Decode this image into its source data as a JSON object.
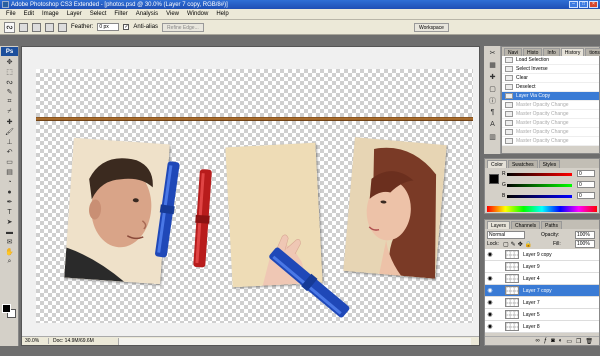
{
  "window": {
    "title": "Adobe Photoshop CS3 Extended - [photos.psd @ 30.0% (Layer 7 copy, RGB/8#)]"
  },
  "menu": [
    "File",
    "Edit",
    "Image",
    "Layer",
    "Select",
    "Filter",
    "Analysis",
    "View",
    "Window",
    "Help"
  ],
  "options": {
    "feather_label": "Feather:",
    "feather_value": "0 px",
    "antialias_label": "Anti-alias",
    "refine_label": "Refine Edge...",
    "workspace_label": "Workspace"
  },
  "toolbox": {
    "badge": "Ps"
  },
  "document": {
    "zoom": "30.0%",
    "doc_info": "Doc: 14.9M/69.6M"
  },
  "history": {
    "tabs": [
      "Navi",
      "Histo",
      "Info",
      "History",
      "tions"
    ],
    "rows": [
      {
        "label": "Load Selection",
        "state": "normal"
      },
      {
        "label": "Select Inverse",
        "state": "normal"
      },
      {
        "label": "Clear",
        "state": "normal"
      },
      {
        "label": "Deselect",
        "state": "normal"
      },
      {
        "label": "Layer Via Copy",
        "state": "selected"
      },
      {
        "label": "Master Opacity Change",
        "state": "dim"
      },
      {
        "label": "Master Opacity Change",
        "state": "dim"
      },
      {
        "label": "Master Opacity Change",
        "state": "dim"
      },
      {
        "label": "Master Opacity Change",
        "state": "dim"
      },
      {
        "label": "Master Opacity Change",
        "state": "dim"
      }
    ]
  },
  "color": {
    "tabs": [
      "Color",
      "Swatches",
      "Styles"
    ],
    "channels": [
      {
        "label": "R",
        "value": "0",
        "color": "#d02020"
      },
      {
        "label": "G",
        "value": "0",
        "color": "#20a020"
      },
      {
        "label": "B",
        "value": "0",
        "color": "#2040d0"
      }
    ]
  },
  "layers": {
    "tabs": [
      "Layers",
      "Channels",
      "Paths"
    ],
    "blend_mode": "Normal",
    "opacity_label": "Opacity:",
    "opacity_value": "100%",
    "lock_label": "Lock:",
    "fill_label": "Fill:",
    "fill_value": "100%",
    "rows": [
      {
        "name": "Layer 9 copy",
        "visible": true,
        "selected": false
      },
      {
        "name": "Layer 9",
        "visible": false,
        "selected": false
      },
      {
        "name": "Layer 4",
        "visible": true,
        "selected": false
      },
      {
        "name": "Layer 7 copy",
        "visible": true,
        "selected": true
      },
      {
        "name": "Layer 7",
        "visible": true,
        "selected": false
      },
      {
        "name": "Layer 5",
        "visible": true,
        "selected": false
      },
      {
        "name": "Layer 8",
        "visible": true,
        "selected": false
      }
    ]
  }
}
